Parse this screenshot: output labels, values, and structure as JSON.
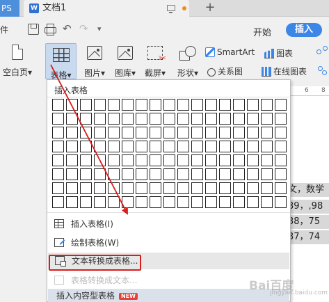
{
  "tabbar": {
    "ps_tab": "PS",
    "doc_tab_title": "文档1"
  },
  "quickbar": {
    "file_menu_fragment": "件",
    "more_symbol": "▾"
  },
  "menus": {
    "start": "开始",
    "insert": "插入"
  },
  "ribbon": {
    "blank_page": "空白页",
    "table": "表格",
    "picture": "图片",
    "gallery": "图库",
    "screenshot": "截屏",
    "shapes": "形状",
    "smartart": "SmartArt",
    "chart": "图表",
    "relation_map": "关系图",
    "online_chart": "在线图表",
    "dropdown_arrow": "▾"
  },
  "dropdown": {
    "title": "插入表格",
    "grid_rows": 8,
    "grid_cols": 17,
    "items": {
      "insert_table": "插入表格(I)",
      "draw_table": "绘制表格(W)",
      "text_to_table": "文本转换成表格...",
      "table_to_text": "表格转换成文本...",
      "content_table": "插入内容型表格",
      "new_badge": "NEW"
    }
  },
  "document": {
    "ruler_marks": [
      "6",
      "8"
    ],
    "lines": [
      "文，数学",
      "39，,98",
      "38，75",
      "37，74"
    ]
  },
  "watermark": {
    "brand": "Bai百度",
    "sub": "jingyan.baidu.com"
  },
  "colors": {
    "accent": "#3b86e6",
    "highlight_red": "#d91c1c"
  }
}
